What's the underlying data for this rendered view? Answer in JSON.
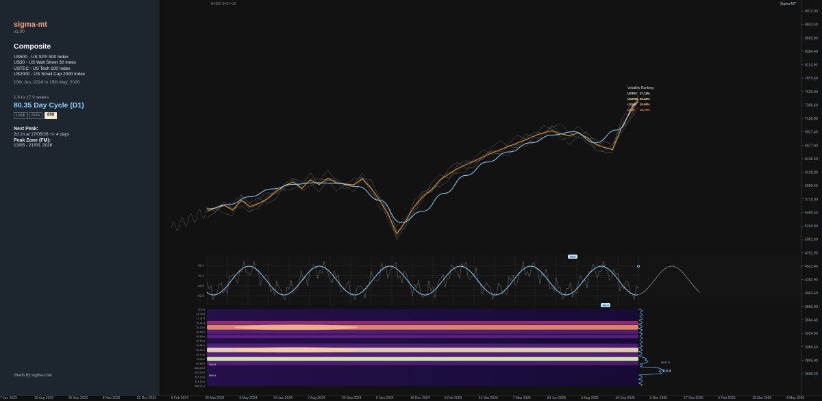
{
  "sidebar": {
    "app_title": "sigma-mt",
    "version": "v1.00",
    "composite_title": "Composite",
    "indices": [
      "US500 - US SPX 500 Index",
      "US30 - US Wall Street 30 Index",
      "USTEC - US Tech 100 Index",
      "US2000 - US Small Cap 2000 Index"
    ],
    "date_range": "10th Jun, 2024 to 15th May, 2026",
    "range_label": "1.8 to 17.9 weeks",
    "cycle_title": "80.35 Day Cycle (D1)",
    "lock_label": "Lock",
    "auto_label": "Auto",
    "cycle_value": "898",
    "next_peak_label": "Next Peak:",
    "next_peak_value": "2d 1h at 17/05/26 +/- 4 days",
    "peak_zone_label": "Peak Zone (FM):",
    "peak_zone_value": "13/05 - 21/05, 2026",
    "credit": "charts by sigma-t.net"
  },
  "header": {
    "params": "N=500  S=0  I=10",
    "brand": "Sigma-MT"
  },
  "colors": {
    "composite": "#f5a623",
    "smooth": "#8fd3ff",
    "indices": "#8a8a8a",
    "sidebar_bg": "#1d252e",
    "chart_bg": "#121212",
    "ranking": [
      "#ffffff",
      "#ffe9a8",
      "#ffc27a",
      "#f08a4b"
    ]
  },
  "chart_data": [
    {
      "type": "line",
      "name": "price",
      "y_ticks": [
        9072.9,
        8833.4,
        8593.9,
        8354.4,
        8114.9,
        7875.4,
        7635.9,
        7396.4,
        7156.9,
        6917.4,
        6677.9,
        6438.4,
        6198.9,
        5959.4,
        5719.9,
        5480.4,
        5240.9,
        5001.4,
        4761.9,
        4522.4,
        4282.9,
        4043.4,
        3803.9,
        3564.4,
        3324.9,
        3085.4,
        2845.9,
        2606.4
      ],
      "y_tick_labels": [
        "9072.90",
        "8833.40",
        "8593.90",
        "8354.40",
        "8114.90",
        "7875.40",
        "7635.90",
        "7396.40",
        "7156.90",
        "6917.40",
        "6677.90",
        "6438.40",
        "6198.90",
        "5959.40",
        "5719.90",
        "5480.40",
        "5240.90",
        "5001.40",
        "4761.90",
        "4522.40",
        "4282.90",
        "4043.40",
        "3803.90",
        "3564.40",
        "3324.90",
        "3085.40",
        "2845.90",
        "2606.40"
      ],
      "x_tick_labels": [
        "7 Jun 2023",
        "10 Aug 2023",
        "25 Sep 2023",
        "8 Nov 2023",
        "22 Dec 2023",
        "9 Feb 2024",
        "25 Mar 2024",
        "9 May 2024",
        "24 Jun 2024",
        "7 Aug 2024",
        "20 Sep 2024",
        "5 Nov 2024",
        "19 Dec 2024",
        "5 Feb 2025",
        "21 Mar 2025",
        "7 May 2025",
        "20 Jun 2025",
        "5 Aug 2025",
        "18 Sep 2025",
        "3 Nov 2025",
        "17 Dec 2025",
        "3 Feb 2026",
        "19 Mar 2026",
        "4 May 2026"
      ],
      "composite": {
        "x": [
          0,
          2,
          4,
          6,
          8,
          10,
          12,
          14,
          16,
          18,
          20,
          22,
          24,
          26,
          28,
          30,
          32,
          34,
          36,
          38,
          40,
          42,
          44,
          46,
          48,
          50,
          52,
          54,
          56,
          58,
          60,
          62,
          64,
          66,
          68,
          70,
          72,
          74,
          76,
          78,
          80,
          82,
          84,
          86,
          88,
          90,
          92,
          94,
          96,
          98,
          100
        ],
        "y": [
          5500,
          5560,
          5610,
          5520,
          5700,
          5580,
          5640,
          5720,
          5850,
          5960,
          6020,
          5910,
          6060,
          5980,
          6090,
          6010,
          5990,
          5970,
          6080,
          5920,
          5700,
          5450,
          5100,
          5320,
          5580,
          5760,
          5880,
          6060,
          6160,
          6260,
          6330,
          6400,
          6470,
          6540,
          6600,
          6660,
          6720,
          6780,
          6850,
          6900,
          6940,
          6880,
          6850,
          6900,
          6820,
          6700,
          6640,
          6600,
          6980,
          7250,
          7500
        ],
        "label": "Composite"
      },
      "smooth": {
        "x": [
          0,
          5,
          10,
          15,
          20,
          25,
          30,
          35,
          40,
          45,
          50,
          55,
          60,
          65,
          70,
          75,
          80,
          85,
          90,
          95,
          100
        ],
        "y": [
          5540,
          5620,
          5760,
          5900,
          5980,
          6010,
          6000,
          5940,
          5700,
          5300,
          5500,
          5820,
          6140,
          6380,
          6560,
          6720,
          6860,
          6920,
          6720,
          6950,
          7440
        ]
      },
      "ranking": {
        "title": "Volatility Ranking",
        "entries": [
          {
            "name": "USTEC",
            "value": "37.13%"
          },
          {
            "name": "US2000",
            "value": "36.48%"
          },
          {
            "name": "US500",
            "value": "26.98%"
          },
          {
            "name": "US30",
            "value": "16.73%"
          }
        ]
      }
    },
    {
      "type": "line",
      "name": "cycle-oscillator",
      "y_tick_labels": [
        "63.4",
        "21.4",
        "-20.6",
        "-62.5"
      ],
      "period_fraction_of_width": 0.1185,
      "peak_label": "60.9",
      "trough_label": "-63.4",
      "ylim": [
        -80,
        80
      ]
    },
    {
      "type": "heatmap",
      "name": "cycle-spectrum",
      "y_tick_labels": [
        "12.6 d",
        "14.73 d",
        "17.37 d",
        "20.41 d",
        "24.13 d",
        "28.49 d",
        "33.63 d",
        "39.70 d",
        "46.86 d",
        "54.92 d",
        "64.74 d",
        "76.32 d",
        "89.98 d",
        "106.13 d",
        "125.19 d",
        "147.73 d",
        "174.32 d",
        "205.71 d"
      ],
      "bands": [
        {
          "period": "20.41 d",
          "intensity": 0.6
        },
        {
          "period": "24.13 d",
          "intensity": 0.9
        },
        {
          "period": "28.49 d",
          "intensity": 0.45
        },
        {
          "period": "33.63 d",
          "intensity": 0.5
        },
        {
          "period": "46.86 d",
          "intensity": 0.4
        },
        {
          "period": "54.92 d",
          "intensity": 0.95
        },
        {
          "period": "64.74 d",
          "intensity": 0.5
        },
        {
          "period": "76.32 d",
          "intensity": 1.0
        },
        {
          "period": "89.98 d",
          "intensity": 0.35
        }
      ],
      "left_labels": [
        "75.0 d",
        "95.8 d"
      ],
      "right_labels": [
        "60.67 d",
        "78.0 d"
      ]
    }
  ]
}
